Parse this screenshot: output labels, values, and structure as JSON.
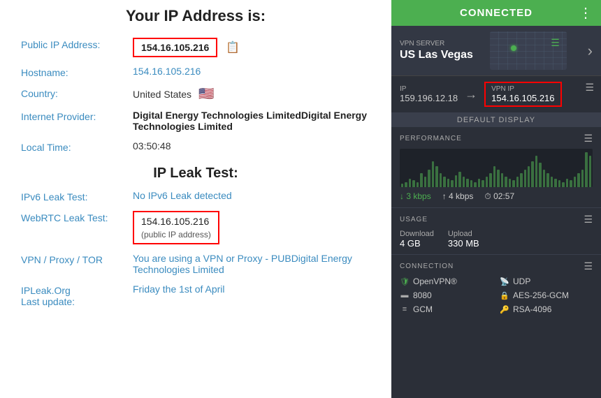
{
  "left": {
    "ip_title": "Your IP Address is:",
    "public_ip_label": "Public IP Address:",
    "public_ip_value": "154.16.105.216",
    "hostname_label": "Hostname:",
    "hostname_value": "154.16.105.216",
    "country_label": "Country:",
    "country_value": "United States",
    "country_flag": "🇺🇸",
    "isp_label": "Internet Provider:",
    "isp_value": "Digital Energy Technologies LimitedDigital Energy Technologies Limited",
    "time_label": "Local Time:",
    "time_value": "03:50:48",
    "leak_title": "IP Leak Test:",
    "ipv6_label": "IPv6 Leak Test:",
    "ipv6_value": "No IPv6 Leak detected",
    "webrtc_label": "WebRTC Leak Test:",
    "webrtc_ip": "154.16.105.216",
    "webrtc_sub": "(public IP address)",
    "webrtc_msg": "You are using a VPN or Proxy - PUBDigital Energy Technologies Limited",
    "vpn_proxy_label": "VPN / Proxy / TOR",
    "ipleak_label": "IPLeak.Org\nLast update:",
    "ipleak_value": "Friday the 1st of April"
  },
  "right": {
    "header": {
      "title": "CONNECTED",
      "dots": "⋮"
    },
    "server": {
      "label": "VPN SERVER",
      "name": "US Las Vegas"
    },
    "ip": {
      "ip_label": "IP",
      "ip_value": "159.196.12.18",
      "vpn_ip_label": "VPN IP",
      "vpn_ip_value": "154.16.105.216"
    },
    "default_display": "DEFAULT DISPLAY",
    "performance": {
      "title": "PERFORMANCE",
      "down": "↓ 3 kbps",
      "up": "↑ 4 kbps",
      "time": "⏱ 02:57",
      "bars": [
        2,
        3,
        5,
        4,
        3,
        8,
        6,
        10,
        15,
        12,
        8,
        6,
        5,
        4,
        7,
        9,
        6,
        5,
        4,
        3,
        5,
        4,
        6,
        8,
        12,
        10,
        8,
        6,
        5,
        4,
        6,
        8,
        10,
        12,
        15,
        18,
        14,
        10,
        8,
        6,
        5,
        4,
        3,
        5,
        4,
        6,
        8,
        10,
        20,
        18
      ]
    },
    "usage": {
      "title": "USAGE",
      "download_label": "Download",
      "download_value": "4 GB",
      "upload_label": "Upload",
      "upload_value": "330 MB"
    },
    "connection": {
      "title": "CONNECTION",
      "items": [
        {
          "icon": "🛡",
          "label": "OpenVPN®",
          "icon_class": "shield"
        },
        {
          "icon": "📡",
          "label": "UDP",
          "icon_class": "monitor"
        },
        {
          "icon": "▬",
          "label": "8080",
          "icon_class": "monitor"
        },
        {
          "icon": "🔒",
          "label": "AES-256-GCM",
          "icon_class": "lock"
        },
        {
          "icon": "≡",
          "label": "GCM",
          "icon_class": "monitor"
        },
        {
          "icon": "🔑",
          "label": "RSA-4096",
          "icon_class": "lock"
        }
      ]
    }
  }
}
